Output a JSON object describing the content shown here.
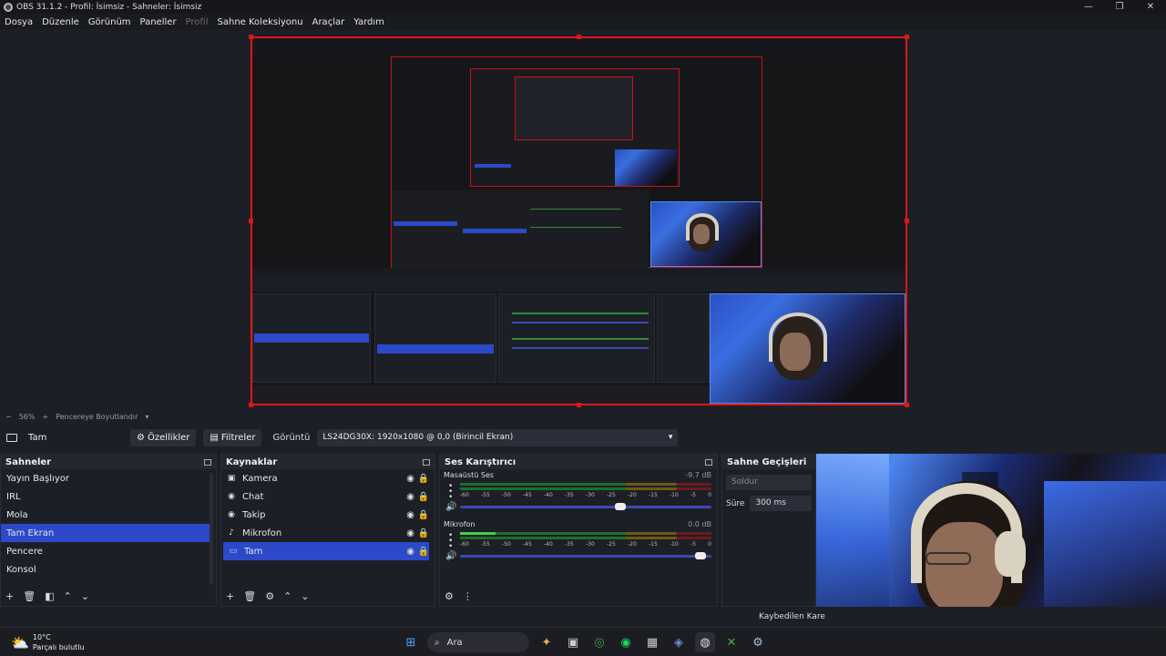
{
  "window": {
    "title": "OBS 31.1.2 - Profil: İsimsiz - Sahneler: İsimsiz",
    "controls": [
      "—",
      "❐",
      "✕"
    ]
  },
  "menu": {
    "items": [
      "Dosya",
      "Düzenle",
      "Görünüm",
      "Paneller",
      "Profil",
      "Sahne Koleksiyonu",
      "Araçlar",
      "Yardım"
    ]
  },
  "zoom": {
    "minus": "−",
    "value": "56%",
    "plus": "+",
    "mode": "Pencereye Boyutlandır",
    "arrow": "▾"
  },
  "source_toolbar": {
    "source_name": "Tam",
    "properties_label": "Özellikler",
    "filters_label": "Filtreler",
    "display_label": "Görüntü",
    "display_value": "LS24DG30X: 1920x1080 @ 0,0 (Birincil Ekran)"
  },
  "scenes": {
    "title": "Sahneler",
    "items": [
      "Yayın Başlıyor",
      "IRL",
      "Mola",
      "Tam Ekran",
      "Pencere",
      "Konsol"
    ],
    "selected": "Tam Ekran"
  },
  "sources": {
    "title": "Kaynaklar",
    "items": [
      {
        "name": "Kamera",
        "icon": "camera-icon",
        "glyph": "▣"
      },
      {
        "name": "Chat",
        "icon": "browser-icon",
        "glyph": "◉"
      },
      {
        "name": "Takip",
        "icon": "browser-icon",
        "glyph": "◉"
      },
      {
        "name": "Mikrofon",
        "icon": "microphone-icon",
        "glyph": "♪"
      },
      {
        "name": "Tam",
        "icon": "monitor-icon",
        "glyph": "▭"
      }
    ],
    "selected": "Tam"
  },
  "mixer": {
    "title": "Ses Karıştırıcı",
    "channels": [
      {
        "name": "Masaüstü Ses",
        "db": "-9.7 dB",
        "volume": 0.66
      },
      {
        "name": "Mikrofon",
        "db": "0.0 dB",
        "volume": 0.98
      }
    ],
    "ticks": [
      "-60",
      "-55",
      "-50",
      "-45",
      "-40",
      "-35",
      "-30",
      "-25",
      "-20",
      "-15",
      "-10",
      "-5",
      "0"
    ]
  },
  "transitions": {
    "title": "Sahne Geçişleri",
    "type": "Soldur",
    "duration_label": "Süre",
    "duration_value": "300 ms"
  },
  "status": {
    "lost_frames": "Kaybedilen Kare"
  },
  "taskbar": {
    "weather_temp": "10°C",
    "weather_desc": "Parçalı bulutlu",
    "search_label": "Ara"
  },
  "colors": {
    "selection": "#2c49c9",
    "canvas_border": "#e01616"
  }
}
